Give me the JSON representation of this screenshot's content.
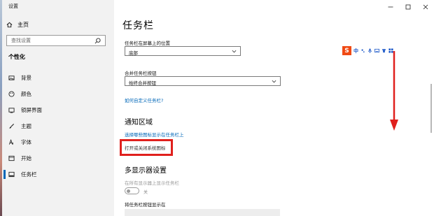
{
  "window": {
    "title": "设置",
    "controls": [
      "minimize",
      "maximize",
      "close"
    ]
  },
  "sidebar": {
    "home_label": "主页",
    "search_placeholder": "查找设置",
    "section_title": "个性化",
    "items": [
      {
        "label": "背景",
        "icon": "picture-icon"
      },
      {
        "label": "颜色",
        "icon": "palette-icon"
      },
      {
        "label": "锁屏界面",
        "icon": "lock-screen-icon"
      },
      {
        "label": "主题",
        "icon": "brush-icon"
      },
      {
        "label": "字体",
        "icon": "font-icon"
      },
      {
        "label": "开始",
        "icon": "start-icon"
      },
      {
        "label": "任务栏",
        "icon": "taskbar-icon",
        "active": true
      }
    ]
  },
  "main": {
    "title": "任务栏",
    "position_label": "任务栏在屏幕上的位置",
    "position_value": "底部",
    "combine_label": "合并任务栏按钮",
    "combine_value": "始终合并按钮",
    "customize_link": "如何自定义任务栏?",
    "notification_heading": "通知区域",
    "select_icons_link": "选择哪些图标显示在任务栏上",
    "system_icons_link": "打开或关闭系统图标",
    "multi_display_heading": "多显示器设置",
    "show_all_label": "在所有显示器上显示任务栏",
    "toggle_state": "关",
    "show_buttons_label": "将任务栏按钮显示在"
  },
  "ime_toolbar": {
    "logo_text": "S",
    "mode_text": "中"
  },
  "colors": {
    "accent": "#0067b8",
    "highlight": "#e0201d",
    "sidebar_bg": "#f2f2f2",
    "ime_logo": "#f04a14"
  }
}
